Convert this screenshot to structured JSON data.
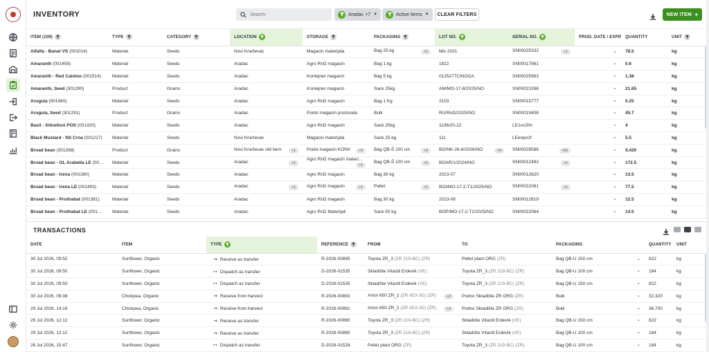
{
  "inventory": {
    "title": "INVENTORY",
    "search_placeholder": "Search",
    "chip_location": "Aradac +7",
    "chip_status": "Active items",
    "clear_label": "CLEAR FILTERS",
    "new_label": "NEW ITEM",
    "new_plus": "+",
    "columns": [
      "ITEM (109)",
      "TYPE",
      "CATEGORY",
      "LOCATION",
      "STORAGE",
      "PACKAGING",
      "LOT NO.",
      "SERIAL NO.",
      "PROD. DATE / EXPIRY DATE",
      "QUANTITY",
      "UNIT"
    ],
    "rows": [
      [
        "Alfalfa - Banat VS",
        "(001014)",
        "Material",
        "Seeds",
        "Novi Kneževac",
        "",
        "Magacin materijala",
        "",
        "Bag 25 kg",
        "+1",
        "Mix 2021",
        "",
        "SN00025332",
        "+1",
        "78.5",
        "kg"
      ],
      [
        "Amaranth",
        "(001459)",
        "Material",
        "Seeds",
        "Aradac",
        "",
        "Agro RnD magacin",
        "",
        "Bag 1 kg",
        "",
        "1822",
        "",
        "SN00017961",
        "",
        "0.6",
        "kg"
      ],
      [
        "Amaranth - Red Caloloo",
        "(001514)",
        "Material",
        "Seeds",
        "Aradac",
        "",
        "Kontejner magacin",
        "",
        "Bag 5 kg",
        "",
        "0125277CINOGA",
        "",
        "SN00025963",
        "",
        "1.38",
        "kg"
      ],
      [
        "Amaranth, Seed",
        "(301290)",
        "Product",
        "Grains",
        "Aradac",
        "",
        "Kontejner magacin",
        "",
        "Sack 25kg",
        "",
        "AM/MO-17-8/2025/NO",
        "",
        "SN00023268",
        "",
        "21.65",
        "kg"
      ],
      [
        "Arugula",
        "(001460)",
        "Material",
        "Seeds",
        "Aradac",
        "",
        "Agro RnD magacin",
        "",
        "Bag 1 Kg",
        "",
        "2103",
        "",
        "SN00015777",
        "",
        "0.25",
        "kg"
      ],
      [
        "Arugula, Seed",
        "(301291)",
        "Product",
        "Grains",
        "Aradac",
        "",
        "Podni magacin proizvoda",
        "",
        "Bulk",
        "",
        "RU/RnD/2025/NO",
        "",
        "SN00019408",
        "",
        "45.7",
        "kg"
      ],
      [
        "Basil - Sitnolisni POS",
        "(001320)",
        "Material",
        "Seeds",
        "Aradac",
        "",
        "Agro RnD magacin",
        "",
        "Sack 25kg",
        "",
        "1136/20-22",
        "",
        "LE1vv2fm",
        "",
        "4",
        "kg"
      ],
      [
        "Black Mustard - NS Crna",
        "(001217)",
        "Material",
        "Seeds",
        "Novi Kneževac",
        "",
        "Magacin materijala",
        "",
        "Sack 25 kg",
        "",
        "111",
        "",
        "LEenpo1f",
        "",
        "5.5",
        "kg"
      ],
      [
        "Broad bean",
        "(301268)",
        "Product",
        "Grains",
        "Novi Kneževac old farm",
        "+1",
        "Podni magacin KONV",
        "+3",
        "Bag QB-Š 100 cm",
        "+2",
        "BO/NK-26-8/2026/NO",
        "+6",
        "SN00028566",
        "+16",
        "9,420",
        "kg"
      ],
      [
        "Broad bean - GL Arabella LE",
        "(00149...",
        "Material",
        "Seeds",
        "Aradac",
        "+1",
        "Agro RnD magacin materi...",
        "+1",
        "Bag QB-Š 100 cm",
        "+1",
        "BOAR/1/2024/NO",
        "",
        "SN00012492",
        "+1",
        "172.5",
        "kg"
      ],
      [
        "Broad bean - Irena",
        "(001380)",
        "Material",
        "Seeds",
        "Aradac",
        "",
        "Agro RnD magacin",
        "",
        "Bag 30 kg",
        "",
        "2023-07",
        "",
        "SN00012620",
        "",
        "13.5",
        "kg"
      ],
      [
        "Broad bean - Irena LE",
        "(001493)",
        "Material",
        "Seeds",
        "Aradac",
        "+1",
        "Agro RnD magacin",
        "+1",
        "Pallet",
        "+1",
        "BOI/MO-17-2-T1/2025/NO",
        "",
        "SN00022081",
        "+1",
        "77.5",
        "kg"
      ],
      [
        "Broad bean - Prothabat",
        "(001381)",
        "Material",
        "Seeds",
        "Aradac",
        "",
        "Agro RnD magacin",
        "",
        "Bag 30 kg",
        "",
        "2023-08",
        "",
        "SN00012619",
        "",
        "12.5",
        "kg"
      ],
      [
        "Broad bean - Prothabat LE",
        "(00149...",
        "Material",
        "Seeds",
        "Aradac",
        "",
        "Agro RnD Materijali",
        "",
        "Sack 50 kg",
        "",
        "BOP/MO-17-2-T2/2025/NO",
        "",
        "SN00022064",
        "",
        "14.5",
        "kg"
      ]
    ]
  },
  "transactions": {
    "title": "TRANSACTIONS",
    "columns": [
      "DATE",
      "ITEM",
      "TYPE",
      "REFERENCE",
      "FROM",
      "TO",
      "PACKAGING",
      "QUANTITY",
      "UNIT"
    ],
    "rows": [
      [
        "30 Jul 2026, 09:52",
        "Sunflower, Organic",
        "⇥",
        "Receive as transfer",
        "R-2026-00895",
        "Toyota ZR_3",
        "(ZR 219-BC)",
        "(ZR)",
        "",
        "Pellet plant ORG",
        "(ZR)",
        "",
        "Bag QB-U 150 cm",
        "822",
        "kg"
      ],
      [
        "30 Jul 2026, 09:50",
        "Sunflower, Organic",
        "↦",
        "Dispatch as transfer",
        "D-2026-01535",
        "Skladište Vitastil Erdevik",
        "",
        "(VE)",
        "",
        "Toyota ZR_3",
        "(ZR 219-BC)",
        "(ZR)",
        "Bag QB-U 100 cm",
        "184",
        "kg"
      ],
      [
        "30 Jul 2026, 09:50",
        "Sunflower, Organic",
        "↦",
        "Dispatch as transfer",
        "D-2026-01535",
        "Skladište Vitastil Erdevik",
        "",
        "(VE)",
        "",
        "Toyota ZR_3",
        "(ZR 219-BC)",
        "(ZR)",
        "Bag QB-U 150 cm",
        "822",
        "kg"
      ],
      [
        "30 Jul 2026, 09:38",
        "Chickpea, Organic",
        "⇥",
        "Receive from harvest",
        "R-2026-00893",
        "Arion 650 ZR_2",
        "(ZR AEX-92)",
        "(ZR)",
        "+2",
        "Podno Skladište ZR ORG",
        "",
        "(ZR)",
        "Bulk",
        "32,320",
        "kg"
      ],
      [
        "29 Jul 2026, 14:16",
        "Chickpea, Organic",
        "⇥",
        "Receive from harvest",
        "R-2026-00891",
        "Arion 650 ZR_2",
        "(ZR AEX-92)",
        "(ZR)",
        "+2",
        "Podno Skladište ZR ORG",
        "",
        "(ZR)",
        "Bulk",
        "36,700",
        "kg"
      ],
      [
        "29 Jul 2026, 12:12",
        "Sunflower, Organic",
        "⇥",
        "Receive as transfer",
        "R-2026-00890",
        "Toyota ZR_3",
        "(ZR 219-BC)",
        "(ZR)",
        "",
        "Skladište Vitastil Erdevik",
        "",
        "(VE)",
        "Bag QB-U 150 cm",
        "822",
        "kg"
      ],
      [
        "29 Jul 2026, 12:12",
        "Sunflower, Organic",
        "⇥",
        "Receive as transfer",
        "R-2026-00890",
        "Toyota ZR_3",
        "(ZR 219-BC)",
        "(ZR)",
        "",
        "Skladište Vitastil Erdevik",
        "",
        "(VE)",
        "Bag QB-U 100 cm",
        "184",
        "kg"
      ],
      [
        "28 Jul 2026, 15:47",
        "Sunflower, Organic",
        "↦",
        "Dispatch as transfer",
        "D-2026-01528",
        "Pellet plant ORG",
        "",
        "(ZR)",
        "",
        "Toyota ZR_3",
        "(ZR 219-BC)",
        "(ZR)",
        "Bag QB-U 100 cm",
        "184",
        "kg"
      ]
    ]
  },
  "colors": {
    "accent": "#3c8f1f",
    "highlight": "#e4f3da",
    "logo": "#c0392b"
  },
  "rail_icons": [
    "globe-icon",
    "notes-icon",
    "warehouse-icon",
    "inventory-icon",
    "receive-icon",
    "dispatch-icon",
    "ledger-icon",
    "analytics-icon",
    "sidebar-toggle-icon",
    "settings-icon"
  ]
}
